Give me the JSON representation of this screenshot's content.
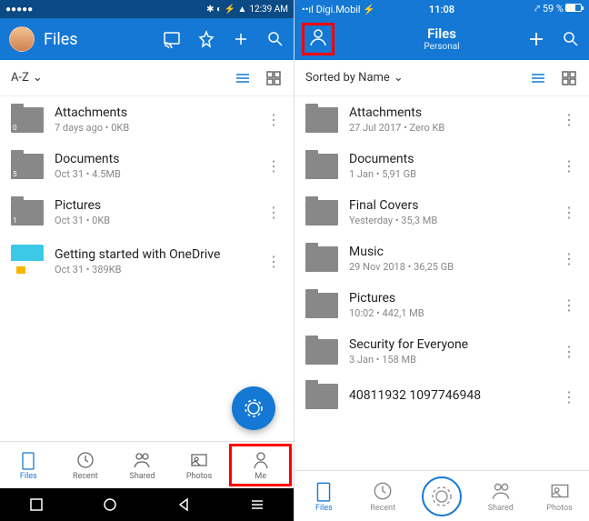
{
  "left": {
    "status": {
      "time": "12:39 AM"
    },
    "title": "Files",
    "sort": "A-Z",
    "items": [
      {
        "name": "Attachments",
        "meta": "7 days ago • 0KB",
        "count": "0"
      },
      {
        "name": "Documents",
        "meta": "Oct 31 • 4.5MB",
        "count": "5"
      },
      {
        "name": "Pictures",
        "meta": "Oct 31 • 0KB",
        "count": "1"
      },
      {
        "name": "Getting started with OneDrive",
        "meta": "Oct 31 • 389KB",
        "thumb": true
      }
    ],
    "tabs": [
      "Files",
      "Recent",
      "Shared",
      "Photos",
      "Me"
    ]
  },
  "right": {
    "status": {
      "carrier": "Digi.Mobil",
      "time": "11:08",
      "battery": "59 %"
    },
    "title": "Files",
    "subtitle": "Personal",
    "sort": "Sorted by Name",
    "items": [
      {
        "name": "Attachments",
        "meta": "27 Jul 2017 • Zero KB"
      },
      {
        "name": "Documents",
        "meta": "1 Jan • 5,91 GB"
      },
      {
        "name": "Final Covers",
        "meta": "Yesterday • 35,3 MB"
      },
      {
        "name": "Music",
        "meta": "29 Nov 2018 • 36,25 GB"
      },
      {
        "name": "Pictures",
        "meta": "10:02 • 442,1 MB"
      },
      {
        "name": "Security for Everyone",
        "meta": "3 Jan • 158 MB"
      },
      {
        "name": "40811932        1097746948",
        "meta": ""
      }
    ],
    "tabs": [
      "Files",
      "Recent",
      "Shared",
      "Photos"
    ]
  }
}
